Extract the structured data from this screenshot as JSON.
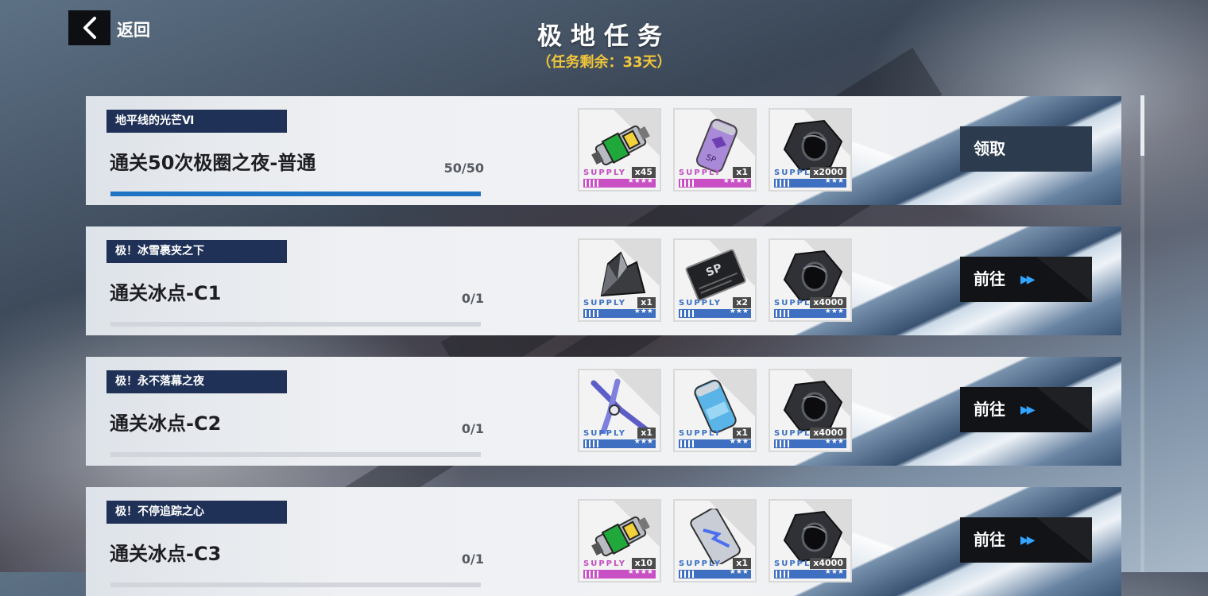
{
  "header": {
    "back_label": "返回",
    "title": "极地任务",
    "subtitle": "（任务剩余：33天）"
  },
  "colors": {
    "tag_bg": "#1f3157",
    "progress_fill": "#1e73c3",
    "subtitle": "#f1c63a",
    "rarity_purple": "#c94fc4",
    "rarity_blue": "#3f6fc0",
    "goto_arrow": "#33a4ff"
  },
  "missions": [
    {
      "tag": "地平线的光芒Ⅵ",
      "title": "通关50次极圈之夜-普通",
      "progress_text": "50/50",
      "progress_fraction": 1.0,
      "action_label": "领取",
      "action_type": "claim",
      "rewards": [
        {
          "icon": "toxic-canister-icon",
          "supply": "SUPPLY",
          "qty": "x45",
          "rarity": "purple",
          "stars": "★★★★"
        },
        {
          "icon": "purple-sp-canister-icon",
          "supply": "SUPPLY",
          "qty": "x1",
          "rarity": "purple",
          "stars": "★★★★"
        },
        {
          "icon": "hex-nut-icon",
          "supply": "SUPPLY",
          "qty": "x2000",
          "rarity": "blue",
          "stars": "★★★"
        }
      ]
    },
    {
      "tag": "极！冰雪裹夹之下",
      "title": "通关冰点-C1",
      "progress_text": "0/1",
      "progress_fraction": 0.0,
      "action_label": "前往",
      "action_type": "goto",
      "rewards": [
        {
          "icon": "crystal-ore-icon",
          "supply": "SUPPLY",
          "qty": "x1",
          "rarity": "blue",
          "stars": "★★★"
        },
        {
          "icon": "sp-chip-icon",
          "supply": "SUPPLY",
          "qty": "x2",
          "rarity": "blue",
          "stars": "★★★"
        },
        {
          "icon": "hex-nut-icon",
          "supply": "SUPPLY",
          "qty": "x4000",
          "rarity": "blue",
          "stars": "★★★"
        }
      ]
    },
    {
      "tag": "极！永不落幕之夜",
      "title": "通关冰点-C2",
      "progress_text": "0/1",
      "progress_fraction": 0.0,
      "action_label": "前往",
      "action_type": "goto",
      "rewards": [
        {
          "icon": "pliers-icon",
          "supply": "SUPPLY",
          "qty": "x1",
          "rarity": "blue",
          "stars": "★★★"
        },
        {
          "icon": "blue-canister-icon",
          "supply": "SUPPLY",
          "qty": "x1",
          "rarity": "blue",
          "stars": "★★★"
        },
        {
          "icon": "hex-nut-icon",
          "supply": "SUPPLY",
          "qty": "x4000",
          "rarity": "blue",
          "stars": "★★★"
        }
      ]
    },
    {
      "tag": "极！不停追踪之心",
      "title": "通关冰点-C3",
      "progress_text": "0/1",
      "progress_fraction": 0.0,
      "action_label": "前往",
      "action_type": "goto",
      "rewards": [
        {
          "icon": "toxic-canister-icon",
          "supply": "SUPPLY",
          "qty": "x10",
          "rarity": "purple",
          "stars": "★★★★"
        },
        {
          "icon": "energy-cell-icon",
          "supply": "SUPPLY",
          "qty": "x1",
          "rarity": "blue",
          "stars": "★★★"
        },
        {
          "icon": "hex-nut-icon",
          "supply": "SUPPLY",
          "qty": "x4000",
          "rarity": "blue",
          "stars": "★★★"
        }
      ]
    }
  ]
}
